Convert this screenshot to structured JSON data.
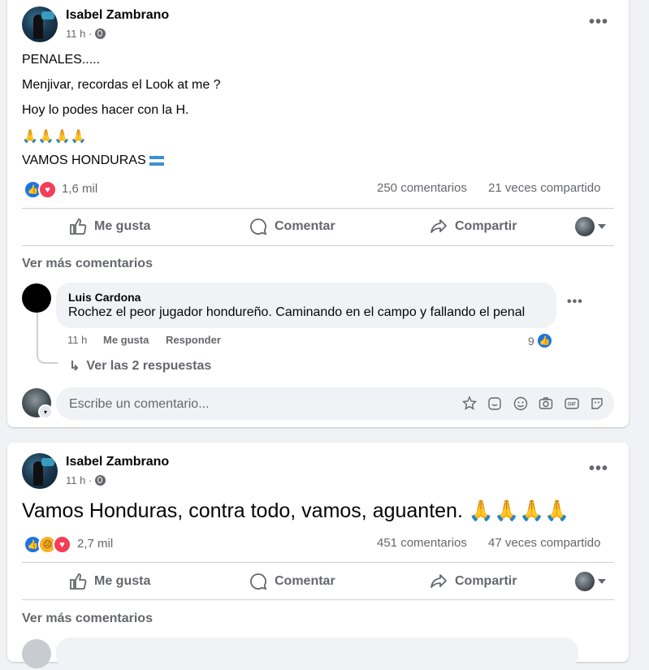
{
  "posts": [
    {
      "author": "Isabel Zambrano",
      "time": "11 h ·",
      "lines": [
        "PENALES.....",
        "Menjivar, recordas el Look at me ?",
        "Hoy lo podes hacer con la H.",
        "🙏🙏🙏🙏",
        "VAMOS HONDURAS"
      ],
      "reaction_count": "1,6 mil",
      "comments_count": "250 comentarios",
      "shares_count": "21 veces compartido",
      "actions": {
        "like": "Me gusta",
        "comment": "Comentar",
        "share": "Compartir"
      },
      "see_more": "Ver más comentarios",
      "comment": {
        "name": "Luis Cardona",
        "text": "Rochez el peor jugador hondureño. Caminando en el campo y fallando el penal",
        "time": "11 h",
        "like_label": "Me gusta",
        "reply_label": "Responder",
        "like_count": "9"
      },
      "replies_label": "Ver las 2 respuestas",
      "input_placeholder": "Escribe un comentario..."
    },
    {
      "author": "Isabel Zambrano",
      "time": "11 h ·",
      "text": "Vamos Honduras, contra todo, vamos, aguanten.",
      "pray": "🙏🙏🙏🙏",
      "reaction_count": "2,7 mil",
      "comments_count": "451 comentarios",
      "shares_count": "47 veces compartido",
      "actions": {
        "like": "Me gusta",
        "comment": "Comentar",
        "share": "Compartir"
      },
      "see_more": "Ver más comentarios"
    }
  ],
  "colors": {
    "accent": "#1b74e4",
    "love": "#f33e58",
    "muted": "#65676b",
    "background": "#f0f2f5"
  }
}
